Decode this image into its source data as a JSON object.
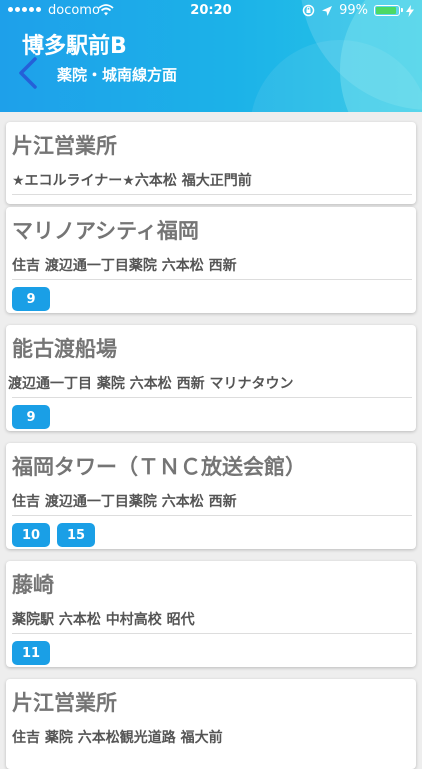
{
  "status_bar": {
    "carrier": "docomo",
    "time": "20:20",
    "battery": "99%",
    "battery_level": 0.99
  },
  "header": {
    "title": "博多駅前B",
    "subtitle": "薬院・城南線方面",
    "back_icon": "chevron-left-icon"
  },
  "colors": {
    "header": "#1ea0ea",
    "badge": "#1a9fe6",
    "battery": "#4cd964"
  },
  "routes": [
    {
      "destination": "片江営業所",
      "via": "★エコルライナー★六本松 福大正門前",
      "numbers": []
    },
    {
      "destination": "マリノアシティ福岡",
      "via": "住吉 渡辺通一丁目薬院 六本松 西新",
      "numbers": [
        "9"
      ]
    },
    {
      "destination": "能古渡船場",
      "via": "渡辺通一丁目 薬院 六本松 西新 マリナタウン",
      "numbers": [
        "9"
      ]
    },
    {
      "destination": "福岡タワー（ＴＮＣ放送会館）",
      "via": "住吉 渡辺通一丁目薬院 六本松 西新",
      "numbers": [
        "10",
        "15"
      ]
    },
    {
      "destination": "藤崎",
      "via": "薬院駅 六本松 中村高校 昭代",
      "numbers": [
        "11"
      ]
    },
    {
      "destination": "片江営業所",
      "via": "住吉 薬院 六本松観光道路 福大前",
      "numbers": []
    }
  ]
}
